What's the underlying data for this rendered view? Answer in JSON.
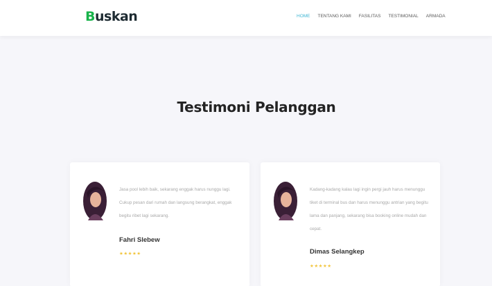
{
  "brand": {
    "name": "Buskan"
  },
  "nav": {
    "items": [
      {
        "label": "HOME"
      },
      {
        "label": "TENTANG KAMI"
      },
      {
        "label": "FASILITAS"
      },
      {
        "label": "TESTIMONIAL"
      },
      {
        "label": "ARMADA"
      }
    ],
    "active_index": 0
  },
  "section": {
    "title": "Testimoni Pelanggan"
  },
  "testimonials": [
    {
      "quote": "Jasa pool lebih baik, sekarang enggak harus nunggu lagi. Cukup pesan dari rumah dan langsung berangkat, enggak begitu ribet lagi sekarang.",
      "name": "Fahri Slebew",
      "rating": "★★★★★"
    },
    {
      "quote": "Kadang-kadang kalau lagi ingin pergi jauh harus menunggu tiket di terminal bus dan harus menunggu antrian yang begitu lama dan panjang, sekarang bisa booking online mudah dan cepat.",
      "name": "Dimas Selangkep",
      "rating": "★★★★★"
    }
  ],
  "colors": {
    "accent": "#3fb6d3",
    "brand_mark": "#18b34a",
    "star": "#f2c53d",
    "page_bg": "#f6f6fa"
  }
}
